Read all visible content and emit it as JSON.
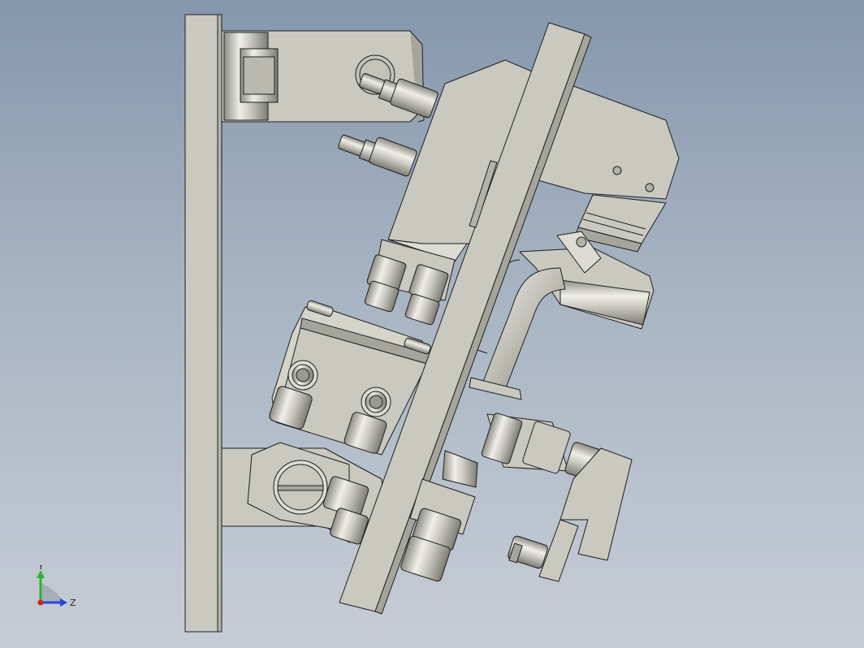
{
  "viewport": {
    "background_top": "#8597ad",
    "background_bottom": "#c7cdd6",
    "part_fill": "#c9c9c0",
    "part_fill_light": "#dcdcd4",
    "part_fill_dark": "#a5a59b",
    "edge_color": "#1e1e1e"
  },
  "triad": {
    "y_label": "Y",
    "z_label": "Z",
    "y_color": "#2fb52f",
    "z_color": "#2646e0",
    "x_color": "#d42020"
  }
}
